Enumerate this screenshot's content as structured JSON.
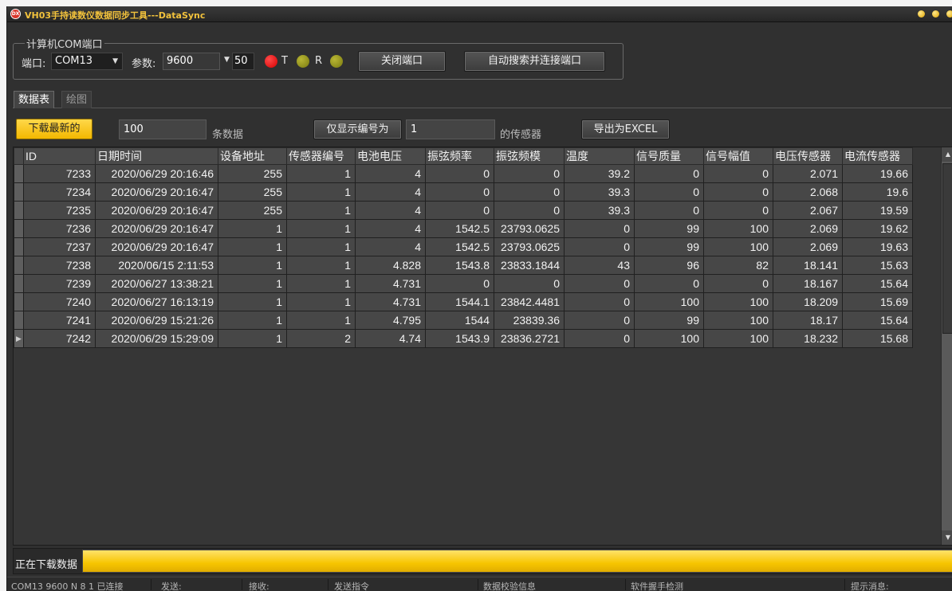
{
  "window": {
    "title": "VH03手持读数仪数据同步工具---DataSync",
    "icon_text": "DX"
  },
  "com": {
    "group_label": "计算机COM端口",
    "port_label": "端口:",
    "port_value": "COM13",
    "param_label": "参数:",
    "baud_value": "9600",
    "timeout_value": "50",
    "t_label": "T",
    "r_label": "R",
    "close_port_label": "关闭端口",
    "auto_search_label": "自动搜索并连接端口",
    "colors": {
      "status_led": "#e60000",
      "t_led": "#9c9a1e",
      "r_led": "#9c9a1e"
    }
  },
  "tabs": [
    {
      "label": "数据表",
      "active": true
    },
    {
      "label": "绘图",
      "active": false
    }
  ],
  "toolbar": {
    "download_label": "下载最新的",
    "count_value": "100",
    "count_suffix": "条数据",
    "filter_label": "仅显示编号为",
    "sensor_id_value": "1",
    "sensor_suffix": "的传感器",
    "export_label": "导出为EXCEL"
  },
  "table": {
    "columns": [
      "ID",
      "日期时间",
      "设备地址",
      "传感器编号",
      "电池电压",
      "振弦频率",
      "振弦频模",
      "温度",
      "信号质量",
      "信号幅值",
      "电压传感器",
      "电流传感器"
    ],
    "rows": [
      [
        "7233",
        "2020/06/29 20:16:46",
        "255",
        "1",
        "4",
        "0",
        "0",
        "39.2",
        "0",
        "0",
        "2.071",
        "19.66"
      ],
      [
        "7234",
        "2020/06/29 20:16:47",
        "255",
        "1",
        "4",
        "0",
        "0",
        "39.3",
        "0",
        "0",
        "2.068",
        "19.6"
      ],
      [
        "7235",
        "2020/06/29 20:16:47",
        "255",
        "1",
        "4",
        "0",
        "0",
        "39.3",
        "0",
        "0",
        "2.067",
        "19.59"
      ],
      [
        "7236",
        "2020/06/29 20:16:47",
        "1",
        "1",
        "4",
        "1542.5",
        "23793.0625",
        "0",
        "99",
        "100",
        "2.069",
        "19.62"
      ],
      [
        "7237",
        "2020/06/29 20:16:47",
        "1",
        "1",
        "4",
        "1542.5",
        "23793.0625",
        "0",
        "99",
        "100",
        "2.069",
        "19.63"
      ],
      [
        "7238",
        "2020/06/15 2:11:53",
        "1",
        "1",
        "4.828",
        "1543.8",
        "23833.1844",
        "43",
        "96",
        "82",
        "18.141",
        "15.63"
      ],
      [
        "7239",
        "2020/06/27 13:38:21",
        "1",
        "1",
        "4.731",
        "0",
        "0",
        "0",
        "0",
        "0",
        "18.167",
        "15.64"
      ],
      [
        "7240",
        "2020/06/27 16:13:19",
        "1",
        "1",
        "4.731",
        "1544.1",
        "23842.4481",
        "0",
        "100",
        "100",
        "18.209",
        "15.69"
      ],
      [
        "7241",
        "2020/06/29 15:21:26",
        "1",
        "1",
        "4.795",
        "1544",
        "23839.36",
        "0",
        "99",
        "100",
        "18.17",
        "15.64"
      ],
      [
        "7242",
        "2020/06/29 15:29:09",
        "1",
        "2",
        "4.74",
        "1543.9",
        "23836.2721",
        "0",
        "100",
        "100",
        "18.232",
        "15.68"
      ]
    ],
    "current_row_index": 9
  },
  "progress": {
    "label": "正在下载数据",
    "fraction": 1.0,
    "color": "#f7c500"
  },
  "statusbar": {
    "connection": "COM13 9600 N 8 1 已连接",
    "send": "发送:",
    "receive": "接收:",
    "command": "发送指令",
    "checksum": "数据校验信息",
    "handshake": "软件握手检测",
    "hint": "提示消息:"
  }
}
